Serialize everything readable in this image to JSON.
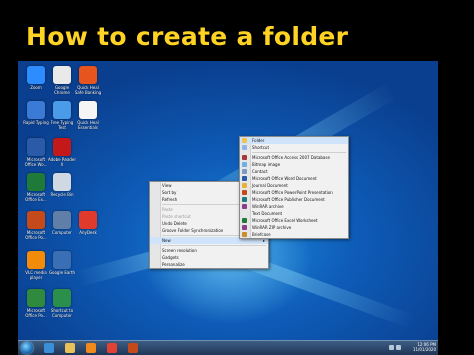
{
  "slide": {
    "title": "How to create a folder"
  },
  "desktop_icons": [
    {
      "label": "Zoom",
      "color": "#2d8cff"
    },
    {
      "label": "Google Chrome",
      "color": "#e9e9e9"
    },
    {
      "label": "Quick Heal Safe Banking",
      "color": "#e8541d"
    },
    {
      "label": "Rapid Typing",
      "color": "#3b7bd6"
    },
    {
      "label": "Free Typing Test",
      "color": "#4a9be8"
    },
    {
      "label": "Quick Heal Essentials",
      "color": "#f5f5f5"
    },
    {
      "label": "Microsoft Office Wo...",
      "color": "#2a5aa8"
    },
    {
      "label": "Adobe Reader X",
      "color": "#c4191a"
    },
    {
      "label": "Microsoft Office Ex...",
      "color": "#1f7a3a"
    },
    {
      "label": "Recycle Bin",
      "color": "#cfd8e3"
    },
    {
      "label": "Microsoft Office Po...",
      "color": "#c54a1b"
    },
    {
      "label": "Computer",
      "color": "#5f7fa8"
    },
    {
      "label": "AnyDesk",
      "color": "#e03a2c"
    },
    {
      "label": "VLC media player",
      "color": "#f28a0a"
    },
    {
      "label": "Google Earth",
      "color": "#3b6fb5"
    },
    {
      "label": "Microsoft Office Po...",
      "color": "#2f8a3e"
    },
    {
      "label": "Shortcut to Computer",
      "color": "#2a8f4a"
    }
  ],
  "context_menu": {
    "items": [
      {
        "label": "View",
        "arrow": "▸",
        "disabled": false
      },
      {
        "label": "Sort by",
        "arrow": "▸",
        "disabled": false
      },
      {
        "label": "Refresh",
        "disabled": false
      },
      {
        "sep": true
      },
      {
        "label": "Paste",
        "disabled": true
      },
      {
        "label": "Paste shortcut",
        "disabled": true
      },
      {
        "label": "Undo Delete",
        "shortcut": "Ctrl+Z",
        "disabled": false
      },
      {
        "label": "Groove Folder Synchronization",
        "arrow": "▸",
        "disabled": false
      },
      {
        "sep": true
      },
      {
        "label": "New",
        "arrow": "▸",
        "disabled": false,
        "highlight": true
      },
      {
        "sep": true
      },
      {
        "label": "Screen resolution",
        "disabled": false
      },
      {
        "label": "Gadgets",
        "disabled": false
      },
      {
        "label": "Personalize",
        "disabled": false
      }
    ]
  },
  "new_submenu": {
    "items": [
      {
        "label": "Folder",
        "color": "#f2c44e",
        "highlight": true
      },
      {
        "label": "Shortcut",
        "color": "#8fb6e8"
      },
      {
        "sep": true
      },
      {
        "label": "Microsoft Office Access 2007 Database",
        "color": "#a4373a"
      },
      {
        "label": "Bitmap image",
        "color": "#6fb0e0"
      },
      {
        "label": "Contact",
        "color": "#7a9ac4"
      },
      {
        "label": "Microsoft Office Word Document",
        "color": "#2a5aa8"
      },
      {
        "label": "Journal Document",
        "color": "#e4b23a"
      },
      {
        "label": "Microsoft Office PowerPoint Presentation",
        "color": "#c54a1b"
      },
      {
        "label": "Microsoft Office Publisher Document",
        "color": "#1f7a7a"
      },
      {
        "label": "WinRAR archive",
        "color": "#8a3f8a"
      },
      {
        "label": "Text Document",
        "color": "#e8e8e8"
      },
      {
        "label": "Microsoft Office Excel Worksheet",
        "color": "#1f7a3a"
      },
      {
        "label": "WinRAR ZIP archive",
        "color": "#8a3f8a"
      },
      {
        "label": "Briefcase",
        "color": "#c8902c"
      }
    ]
  },
  "taskbar": {
    "apps": [
      {
        "name": "start",
        "color": "#1f6fb8"
      },
      {
        "name": "internet-explorer",
        "color": "#3a8fd8"
      },
      {
        "name": "file-explorer",
        "color": "#e9c35a"
      },
      {
        "name": "media-player",
        "color": "#f08a1a"
      },
      {
        "name": "chrome",
        "color": "#e34133"
      },
      {
        "name": "powerpoint",
        "color": "#c54a1b"
      }
    ],
    "time": "12:06 PM",
    "date": "11/01/2020"
  }
}
